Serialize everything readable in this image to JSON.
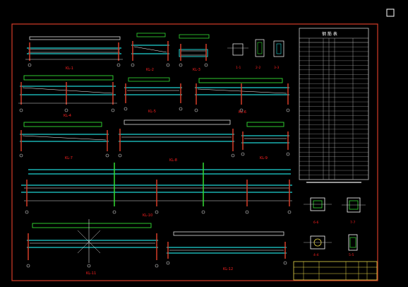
{
  "drawing": {
    "colors": {
      "background": "#000000",
      "frame": "#d43c28",
      "beam": "#1fd4d4",
      "rebar": "#ffffff",
      "dim": "#dcdcdc",
      "label": "#ff2020",
      "green": "#33dd33",
      "yellow": "#e8d84a",
      "table": "#c8c8c8"
    },
    "view_labels": {
      "kl1": "KL-1",
      "kl2": "KL-2",
      "kl3": "KL-3",
      "kl4": "KL-4",
      "kl5": "KL-5",
      "kl6": "KL-6",
      "kl7": "KL-7",
      "kl8": "KL-8",
      "kl9": "KL-9",
      "kl10": "KL-10",
      "kl11": "KL-11",
      "kl12": "KL-12"
    },
    "section_labels": [
      "1-1",
      "2-2",
      "3-3",
      "4-4",
      "5-5",
      "6-6",
      "7-7"
    ],
    "table": {
      "title": "钢 筋 表",
      "row_count": 30
    },
    "title_block": {
      "present": true
    }
  }
}
